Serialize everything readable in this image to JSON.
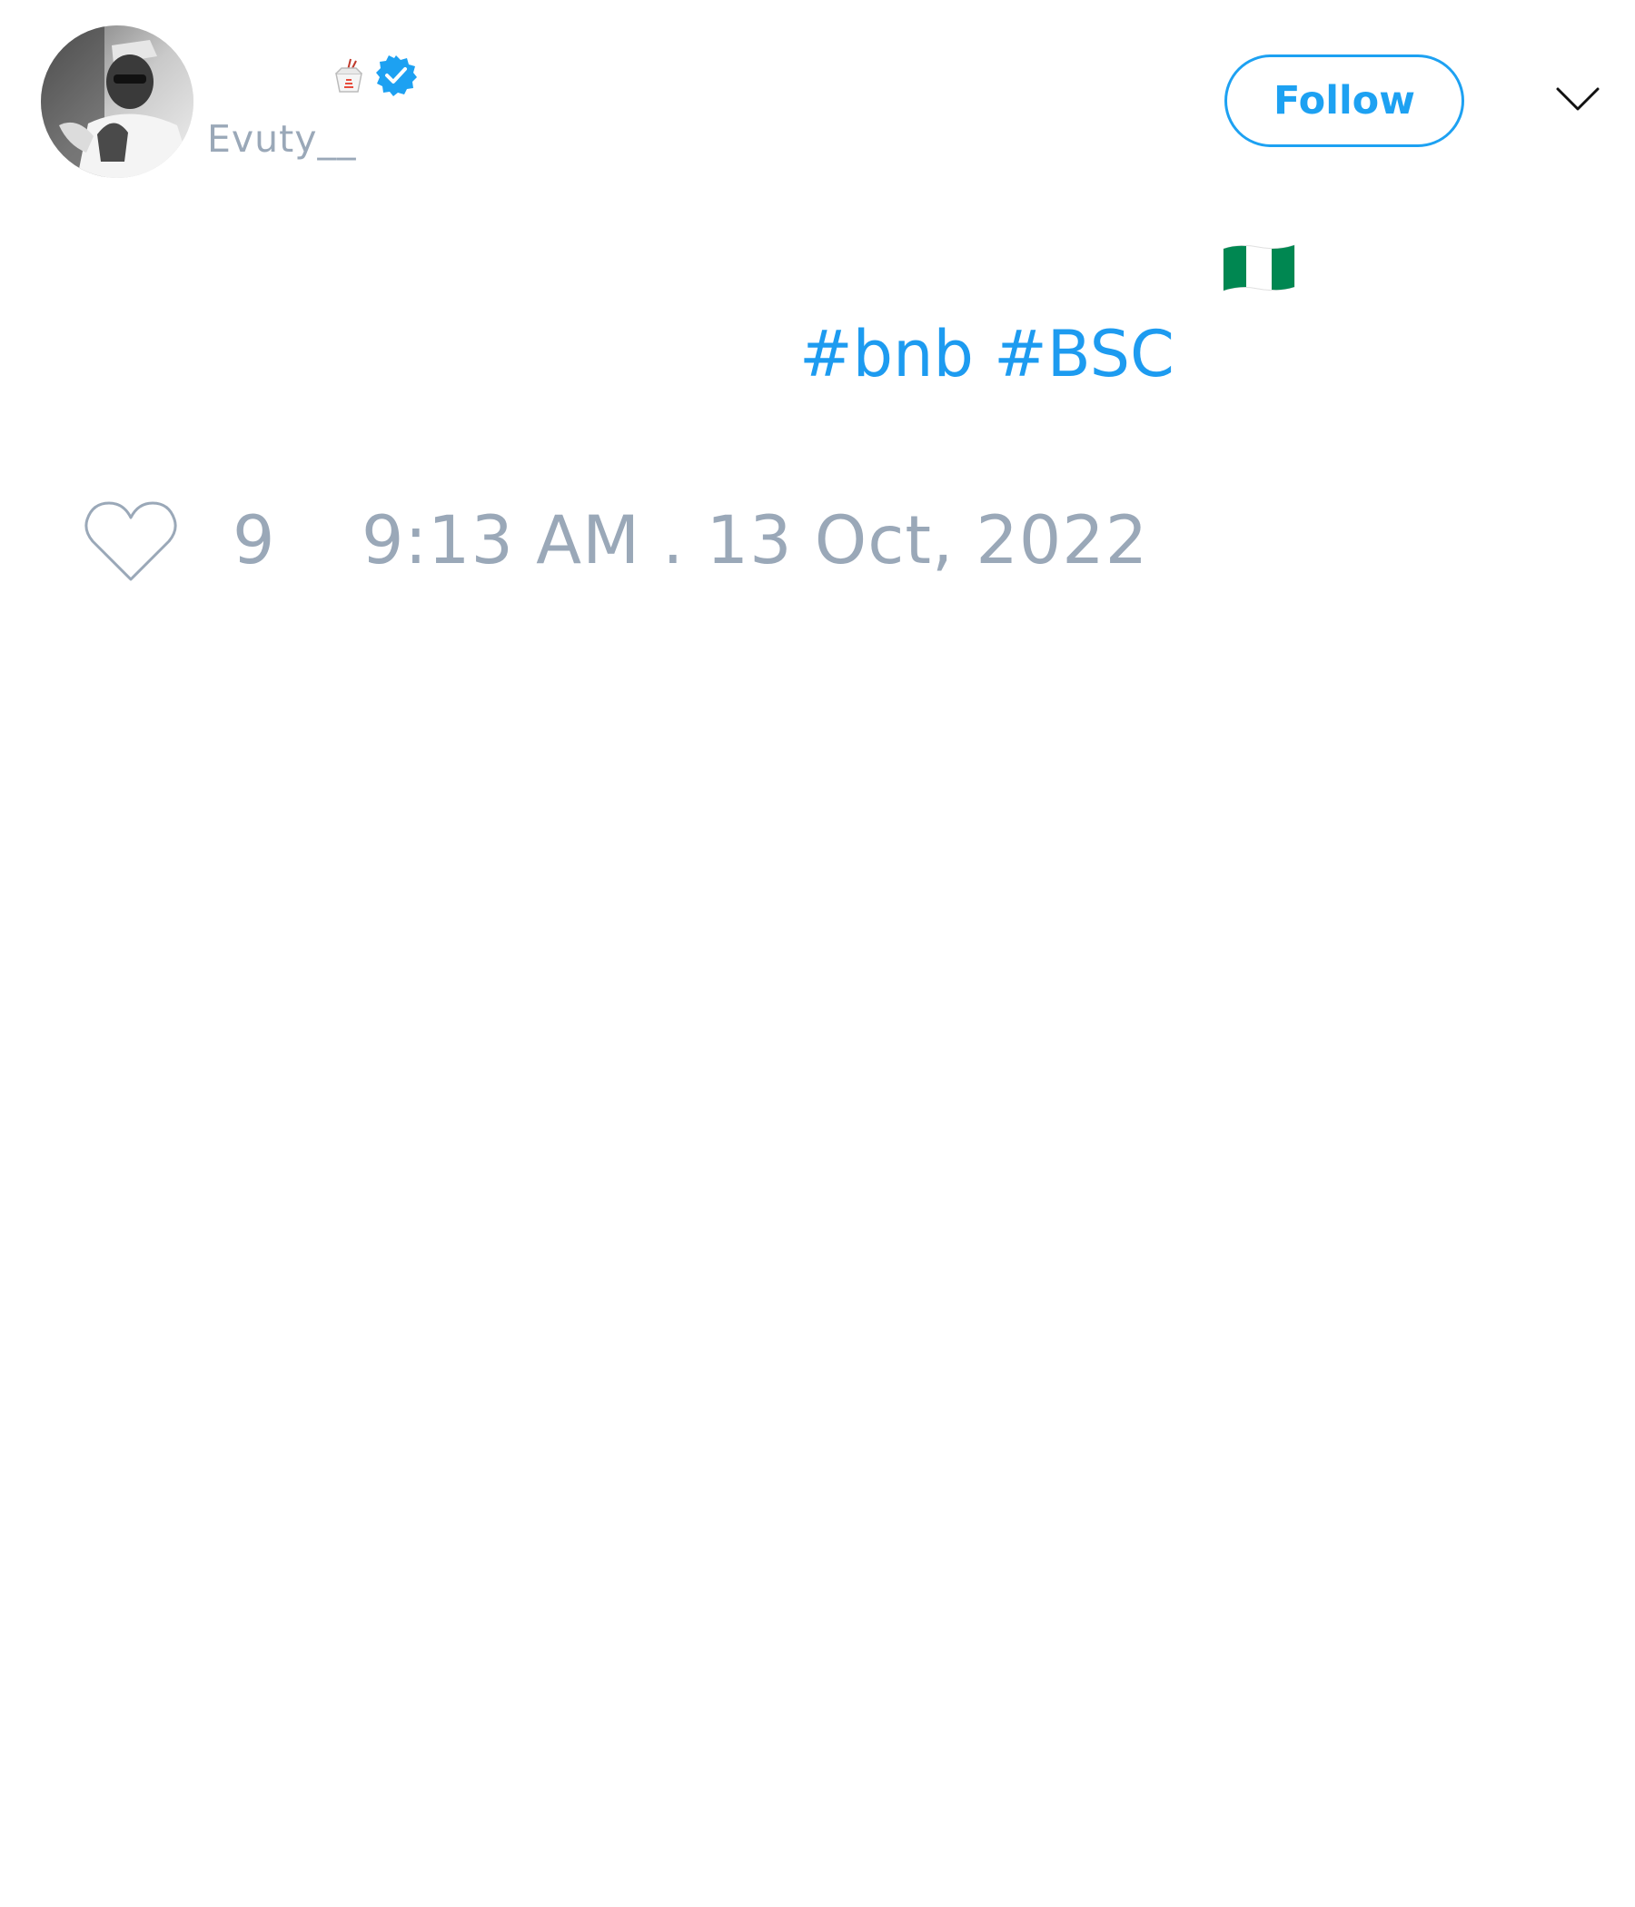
{
  "author": {
    "display_name": "",
    "handle": "Evuty__",
    "name_emoji_icon": "takeout-box-icon",
    "verified_icon": "verified-badge-icon",
    "avatar_icon": "avatar-photo"
  },
  "actions": {
    "follow_label": "Follow",
    "menu_icon": "chevron-down-icon"
  },
  "tweet": {
    "flag_icon": "nigeria-flag-icon",
    "hashtags": [
      "#bnb",
      "#BSC"
    ]
  },
  "footer": {
    "like_icon": "heart-icon",
    "like_count": "9",
    "timestamp": "9:13 AM . 13 Oct, 2022"
  },
  "colors": {
    "accent": "#1da1f2",
    "muted_text": "#9aa8b8",
    "flag_green": "#008751"
  }
}
